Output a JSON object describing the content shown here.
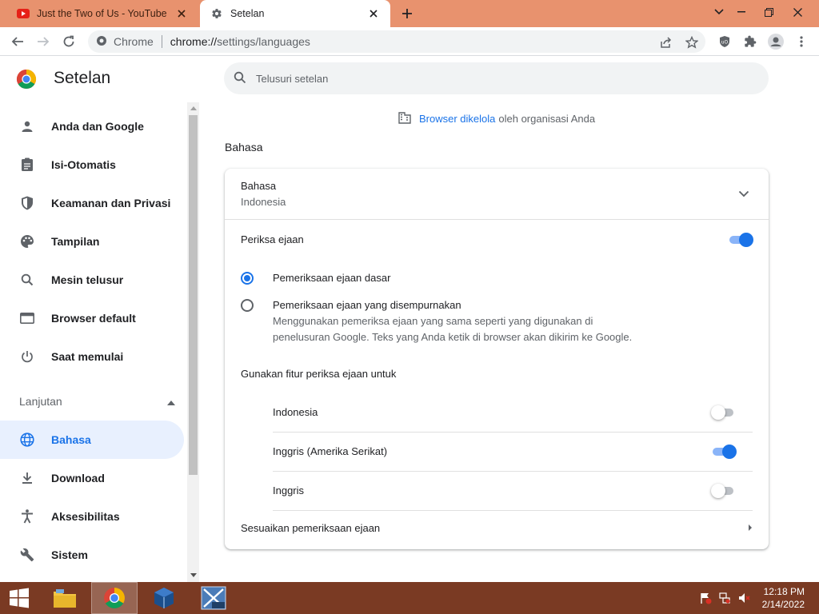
{
  "tabs": [
    {
      "title": "Just the Two of Us - YouTube",
      "icon": "youtube-icon"
    },
    {
      "title": "Setelan",
      "icon": "gear-icon"
    }
  ],
  "omnibox": {
    "security_label": "Chrome",
    "url_host": "chrome://",
    "url_path": "settings/languages"
  },
  "header": {
    "title": "Setelan",
    "search_placeholder": "Telusuri setelan"
  },
  "sidebar": {
    "items": [
      {
        "label": "Anda dan Google",
        "icon": "person-icon"
      },
      {
        "label": "Isi-Otomatis",
        "icon": "clipboard-icon"
      },
      {
        "label": "Keamanan dan Privasi",
        "icon": "shield-icon"
      },
      {
        "label": "Tampilan",
        "icon": "palette-icon"
      },
      {
        "label": "Mesin telusur",
        "icon": "search-icon"
      },
      {
        "label": "Browser default",
        "icon": "browser-icon"
      },
      {
        "label": "Saat memulai",
        "icon": "power-icon"
      }
    ],
    "advanced_label": "Lanjutan",
    "advanced_items": [
      {
        "label": "Bahasa",
        "icon": "globe-icon",
        "active": true
      },
      {
        "label": "Download",
        "icon": "download-icon"
      },
      {
        "label": "Aksesibilitas",
        "icon": "accessibility-icon"
      },
      {
        "label": "Sistem",
        "icon": "wrench-icon"
      }
    ]
  },
  "managed": {
    "link": "Browser dikelola",
    "rest": "oleh organisasi Anda"
  },
  "section_title": "Bahasa",
  "card": {
    "language_label": "Bahasa",
    "language_value": "Indonesia",
    "spellcheck_label": "Periksa ejaan",
    "spellcheck_on": true,
    "basic_label": "Pemeriksaan ejaan dasar",
    "enhanced_label": "Pemeriksaan ejaan yang disempurnakan",
    "enhanced_desc": "Menggunakan pemeriksa ejaan yang sama seperti yang digunakan di penelusuran Google. Teks yang Anda ketik di browser akan dikirim ke Google.",
    "use_for_label": "Gunakan fitur periksa ejaan untuk",
    "languages": [
      {
        "name": "Indonesia",
        "on": false
      },
      {
        "name": "Inggris (Amerika Serikat)",
        "on": true
      },
      {
        "name": "Inggris",
        "on": false
      }
    ],
    "customize_label": "Sesuaikan pemeriksaan ejaan"
  },
  "taskbar": {
    "time": "12:18 PM",
    "date": "2/14/2022"
  },
  "colors": {
    "accent": "#1a73e8",
    "tabbar": "#e8926e",
    "taskbar": "#7a3a23"
  }
}
